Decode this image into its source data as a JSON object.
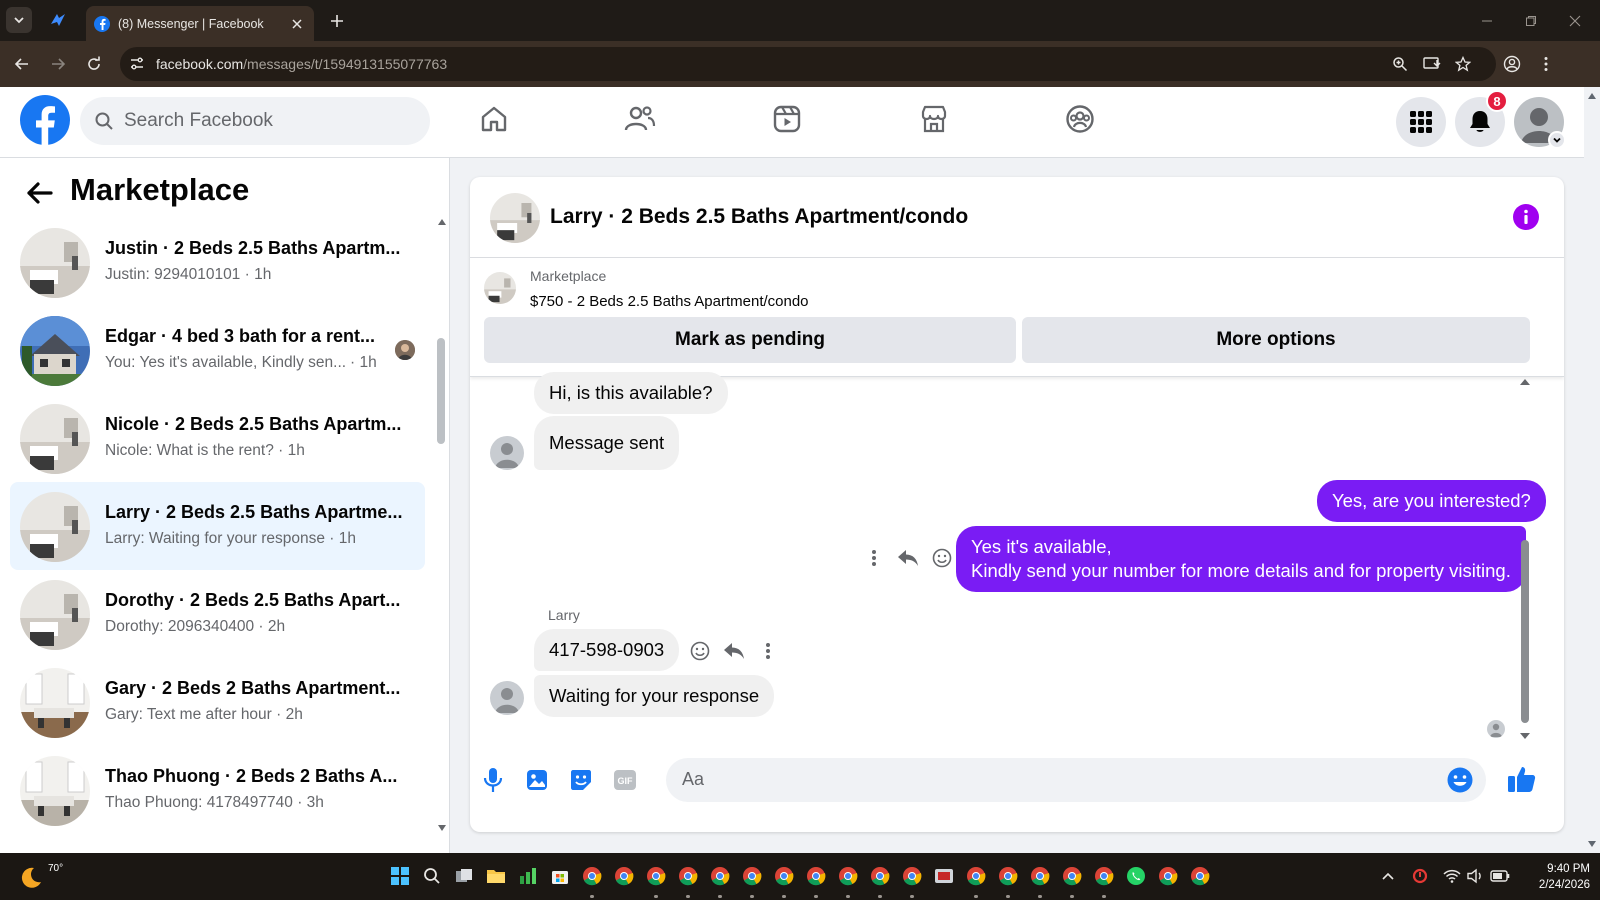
{
  "browser": {
    "tab_title": "(8) Messenger | Facebook",
    "url_domain": "facebook.com",
    "url_path": "/messages/t/1594913155077763"
  },
  "header": {
    "search_placeholder": "Search Facebook",
    "notification_count": "8",
    "nav_icons": [
      "home-icon",
      "friends-icon",
      "watch-icon",
      "marketplace-icon",
      "groups-icon"
    ]
  },
  "sidebar": {
    "title": "Marketplace",
    "conversations": [
      {
        "name": "Justin · 2 Beds 2.5 Baths Apartm...",
        "snippet": "Justin: 9294010101 · 1h"
      },
      {
        "name": "Edgar · 4 bed 3 bath for a rent...",
        "snippet": "You: Yes it's available, Kindly sen...",
        "time": "· 1h"
      },
      {
        "name": "Nicole · 2 Beds 2.5 Baths Apartm...",
        "snippet": "Nicole: What is the rent? · 1h"
      },
      {
        "name": "Larry · 2 Beds 2.5 Baths Apartme...",
        "snippet": "Larry: Waiting for your response · 1h"
      },
      {
        "name": "Dorothy · 2 Beds 2.5 Baths Apart...",
        "snippet": "Dorothy: 2096340400 · 2h"
      },
      {
        "name": "Gary · 2 Beds 2 Baths Apartment...",
        "snippet": "Gary: Text me after hour · 2h"
      },
      {
        "name": "Thao Phuong · 2 Beds 2 Baths A...",
        "snippet": "Thao Phuong: 4178497740 · 3h"
      }
    ]
  },
  "chat": {
    "title": "Larry · 2 Beds 2.5 Baths Apartment/condo",
    "listing": {
      "label": "Marketplace",
      "item": "$750 - 2 Beds 2.5 Baths Apartment/condo",
      "mark_pending": "Mark as pending",
      "more_options": "More options"
    },
    "messages": {
      "m1": "Hi, is this available?",
      "m2": "Message sent",
      "m3": "Yes, are you interested?",
      "m4_line1": "Yes it's available,",
      "m4_line2": "Kindly send your number for more details and for property visiting.",
      "sender": "Larry",
      "m5": "417-598-0903",
      "m6": "Waiting for your response"
    },
    "composer_placeholder": "Aa"
  },
  "taskbar": {
    "temperature": "70°",
    "time": "9:40 PM",
    "date": "2/24/2026"
  },
  "colors": {
    "facebook_blue": "#1877f2",
    "outgoing_bubble": "#7a1cf4",
    "notification_red": "#e41e3f"
  }
}
